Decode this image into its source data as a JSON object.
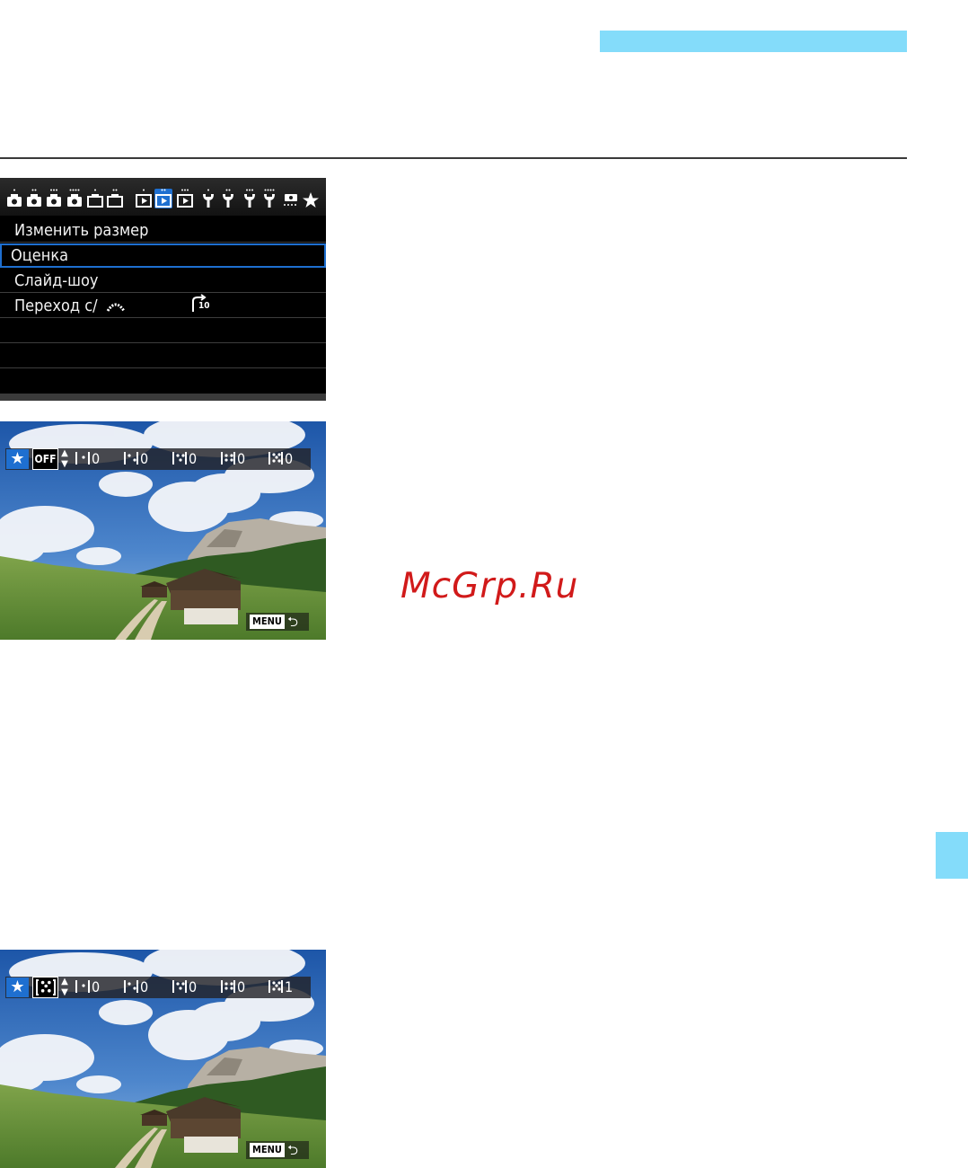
{
  "header": {
    "accent_color": "#84dcfa"
  },
  "menu_screen": {
    "tabs": [
      "camera-1",
      "camera-2",
      "camera-3",
      "camera-4",
      "liveview-1",
      "liveview-2",
      "playback-1",
      "playback-2",
      "playback-3",
      "setup-1",
      "setup-2",
      "setup-3",
      "setup-4",
      "custom-functions",
      "my-menu"
    ],
    "active_tab": "playback-2",
    "items": [
      {
        "label": "Изменить размер",
        "value": ""
      },
      {
        "label": "Оценка",
        "value": "",
        "selected": true
      },
      {
        "label": "Слайд-шоу",
        "value": ""
      },
      {
        "label": "Переход с/",
        "value": "10"
      },
      {
        "label": "",
        "value": ""
      },
      {
        "label": "",
        "value": ""
      },
      {
        "label": "",
        "value": ""
      }
    ],
    "accent_color": "#1e6fd0"
  },
  "rating_screen_1": {
    "current": "OFF",
    "counts": [
      "0",
      "0",
      "0",
      "0",
      "0"
    ],
    "menu_label": "MENU"
  },
  "rating_screen_2": {
    "current_stars": 5,
    "counts": [
      "0",
      "0",
      "0",
      "0",
      "1"
    ],
    "menu_label": "MENU"
  },
  "watermark": "McGrp.Ru"
}
